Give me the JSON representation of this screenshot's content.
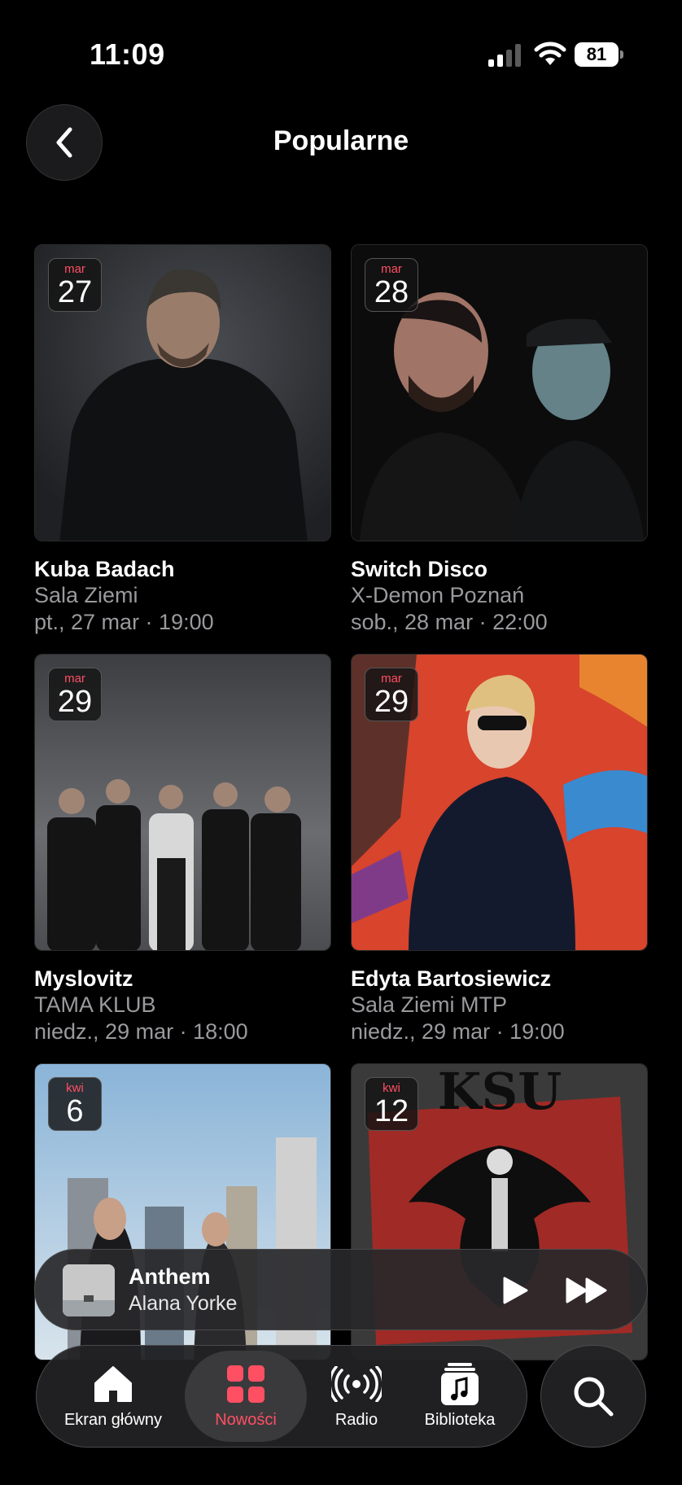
{
  "status_bar": {
    "time": "11:09",
    "battery": "81"
  },
  "header": {
    "title": "Popularne"
  },
  "events": [
    {
      "month": "mar",
      "day": "27",
      "title": "Kuba Badach",
      "venue": "Sala Ziemi",
      "when": "pt., 27 mar · 19:00"
    },
    {
      "month": "mar",
      "day": "28",
      "title": "Switch Disco",
      "venue": "X-Demon Poznań",
      "when": "sob., 28 mar · 22:00"
    },
    {
      "month": "mar",
      "day": "29",
      "title": "Myslovitz",
      "venue": "TAMA KLUB",
      "when": "niedz., 29 mar · 18:00"
    },
    {
      "month": "mar",
      "day": "29",
      "title": "Edyta Bartosiewicz",
      "venue": "Sala Ziemi MTP",
      "when": "niedz., 29 mar · 19:00"
    },
    {
      "month": "kwi",
      "day": "6",
      "title": "",
      "venue": "",
      "when": ""
    },
    {
      "month": "kwi",
      "day": "12",
      "title": "",
      "venue": "",
      "when": "",
      "image_text": "KSU"
    }
  ],
  "now_playing": {
    "title": "Anthem",
    "artist": "Alana Yorke"
  },
  "tabs": [
    {
      "label": "Ekran główny",
      "icon": "home-icon",
      "active": false
    },
    {
      "label": "Nowości",
      "icon": "grid-icon",
      "active": true
    },
    {
      "label": "Radio",
      "icon": "radio-icon",
      "active": false
    },
    {
      "label": "Biblioteka",
      "icon": "library-icon",
      "active": false
    }
  ],
  "colors": {
    "accent": "#ff4f63",
    "background": "#000000",
    "secondary_text": "#9a9a9e"
  }
}
